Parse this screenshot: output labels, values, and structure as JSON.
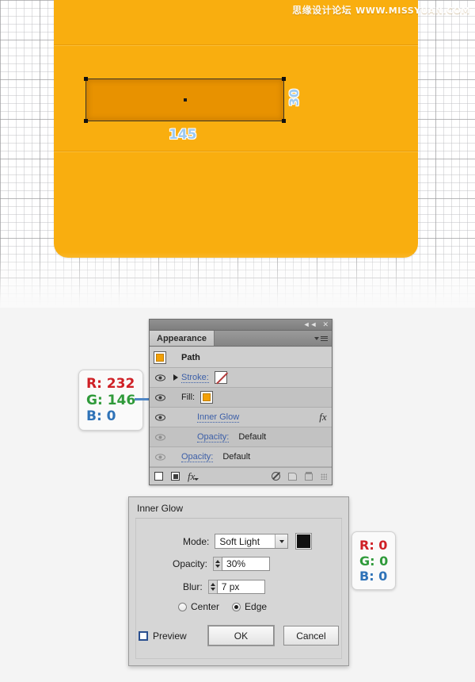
{
  "canvas": {
    "watermark_cn": "思缘设计论坛",
    "watermark_url": "WWW.MISSYUAN.COM",
    "shape": {
      "width_label": "145",
      "height_label": "30",
      "fill_hex": "#E89200",
      "card_hex": "#F9AE0F"
    }
  },
  "rgb_callout_fill": {
    "r": "R: 232",
    "g": "G: 146",
    "b": "B: 0"
  },
  "rgb_callout_glow": {
    "r": "R: 0",
    "g": "G: 0",
    "b": "B: 0"
  },
  "appearance_panel": {
    "tab_label": "Appearance",
    "collapse_icon": "◄◄",
    "close_icon": "✕",
    "rows": [
      {
        "label": "Path",
        "type": "header"
      },
      {
        "label": "Stroke:",
        "swatch": "none"
      },
      {
        "label": "Fill:",
        "swatch": "orange"
      },
      {
        "label": "Inner Glow",
        "fx": "fx"
      },
      {
        "label": "Opacity:",
        "value": "Default"
      },
      {
        "label": "Opacity:",
        "value": "Default"
      }
    ],
    "footer_icons": [
      "add-new-stroke-icon",
      "add-new-fill-icon",
      "add-new-effect-icon",
      "clear-appearance-icon",
      "duplicate-item-icon",
      "delete-item-icon",
      "resize-grip-icon"
    ]
  },
  "inner_glow_dialog": {
    "title": "Inner Glow",
    "mode_label": "Mode:",
    "mode_value": "Soft Light",
    "color_swatch_hex": "#111111",
    "opacity_label": "Opacity:",
    "opacity_value": "30%",
    "blur_label": "Blur:",
    "blur_value": "7 px",
    "radio_center": "Center",
    "radio_edge": "Edge",
    "radio_selected": "Edge",
    "preview_label": "Preview",
    "preview_checked": false,
    "ok_label": "OK",
    "cancel_label": "Cancel"
  }
}
